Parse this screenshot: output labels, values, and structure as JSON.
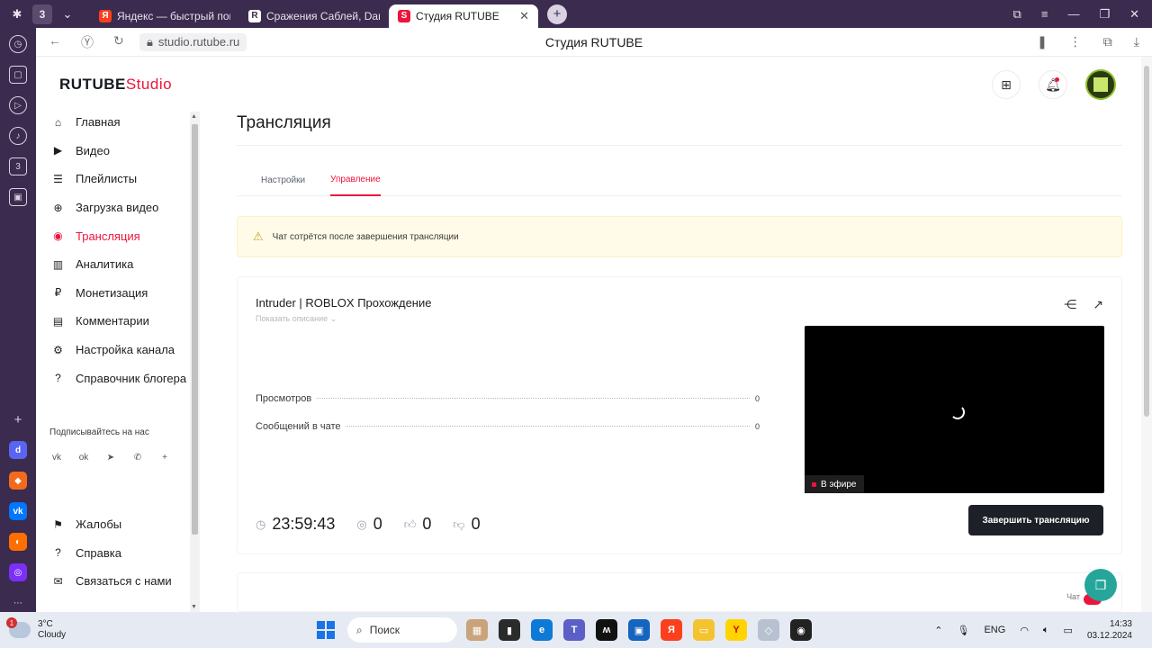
{
  "browser": {
    "tab_count": "3",
    "tabs": [
      {
        "title": "Яндекс — быстрый поиск",
        "fav": "Я",
        "color": "#fc3f1d"
      },
      {
        "title": "Сражения Саблей, Dandy",
        "fav": "R",
        "color": "#ffffff"
      },
      {
        "title": "Студия RUTUBE",
        "fav": "S",
        "color": "#ed143b"
      }
    ],
    "url": "studio.rutube.ru",
    "page_title": "Студия RUTUBE"
  },
  "brand": {
    "name": "RUTUBE",
    "suffix": "Studio",
    "accent": "#ed143b"
  },
  "sidebar": {
    "items": [
      {
        "label": "Главная",
        "icon": "home-icon",
        "glyph": "⌂"
      },
      {
        "label": "Видео",
        "icon": "video-icon",
        "glyph": "▶"
      },
      {
        "label": "Плейлисты",
        "icon": "playlist-icon",
        "glyph": "☰"
      },
      {
        "label": "Загрузка видео",
        "icon": "upload-icon",
        "glyph": "⊕"
      },
      {
        "label": "Трансляция",
        "icon": "broadcast-icon",
        "glyph": "◉"
      },
      {
        "label": "Аналитика",
        "icon": "analytics-icon",
        "glyph": "▥"
      },
      {
        "label": "Монетизация",
        "icon": "ruble-icon",
        "glyph": "₽"
      },
      {
        "label": "Комментарии",
        "icon": "comment-icon",
        "glyph": "▤"
      },
      {
        "label": "Настройка канала",
        "icon": "gear-icon",
        "glyph": "⚙"
      },
      {
        "label": "Справочник блогера",
        "icon": "help-chat-icon",
        "glyph": "?"
      }
    ],
    "active_index": 4,
    "subscribe_label": "Подписывайтесь на нас",
    "social": [
      "vk",
      "ok",
      "telegram",
      "viber",
      "more"
    ],
    "lower_items": [
      {
        "label": "Жалобы",
        "icon": "flag-icon",
        "glyph": "⚑"
      },
      {
        "label": "Справка",
        "icon": "question-icon",
        "glyph": "?"
      },
      {
        "label": "Связаться с нами",
        "icon": "mail-icon",
        "glyph": "✉"
      }
    ]
  },
  "main": {
    "title": "Трансляция",
    "tabs": [
      "Настройки",
      "Управление"
    ],
    "active_tab": 1,
    "alert": "Чат сотрётся после завершения трансляции",
    "stream": {
      "title": "Intruder | ROBLOX Прохождение",
      "show_description": "Показать описание",
      "stats": [
        {
          "label": "Просмотров",
          "value": "0"
        },
        {
          "label": "Сообщений в чате",
          "value": "0"
        }
      ],
      "live_label": "В эфире",
      "timer": "23:59:43",
      "viewers": "0",
      "likes": "0",
      "dislikes": "0",
      "end_button": "Завершить трансляцию"
    },
    "chat_label": "Чат"
  },
  "taskbar": {
    "weather_temp": "3°C",
    "weather_desc": "Cloudy",
    "notification_count": "1",
    "search_label": "Поиск",
    "lang": "ENG",
    "time": "14:33",
    "date": "03.12.2024"
  }
}
